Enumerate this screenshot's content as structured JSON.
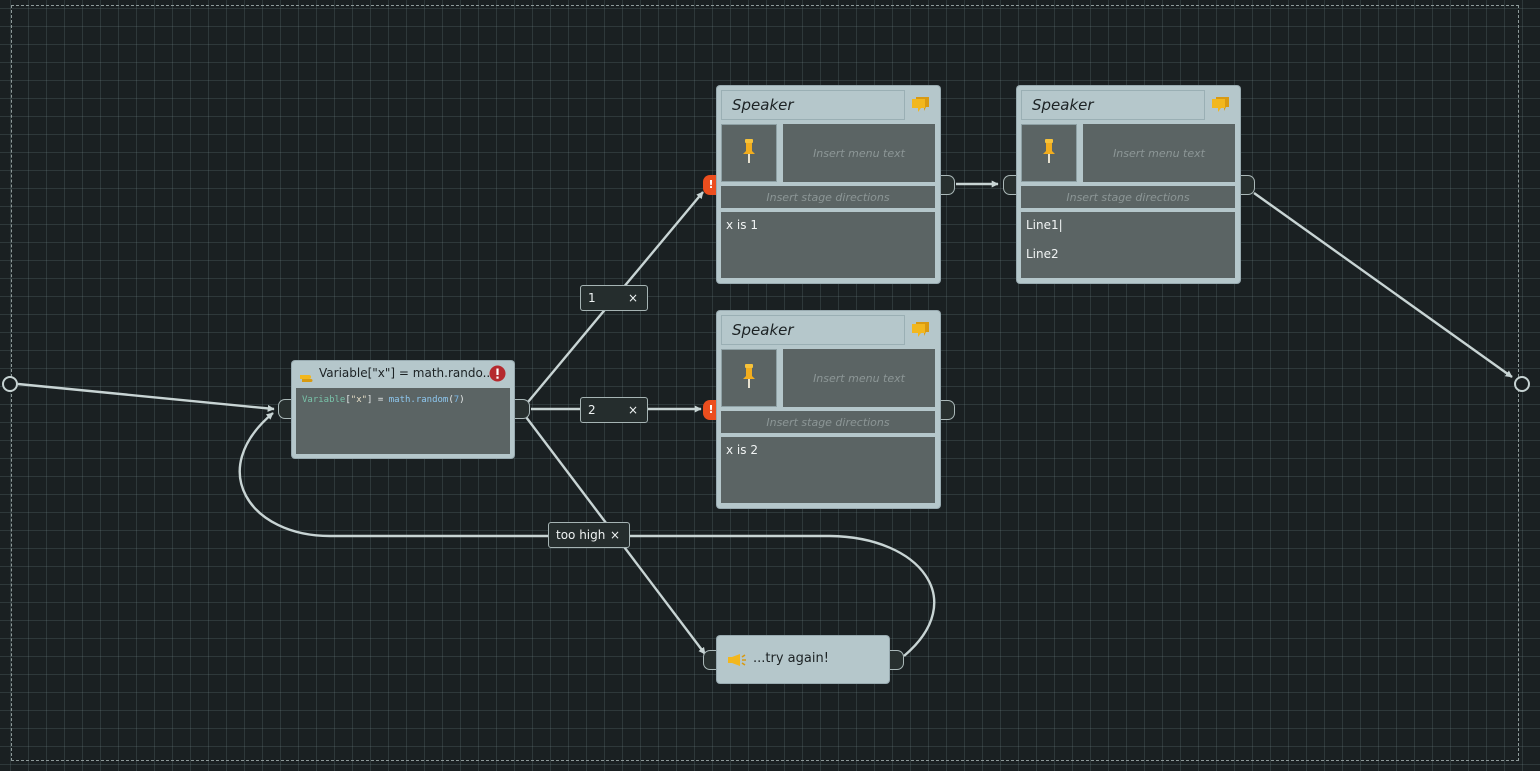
{
  "flow": {
    "speaker_nodes": [
      {
        "speaker": "Speaker",
        "menu_placeholder": "Insert menu text",
        "stage_placeholder": "Insert stage directions",
        "lines": [
          "x is 1"
        ]
      },
      {
        "speaker": "Speaker",
        "menu_placeholder": "Insert menu text",
        "stage_placeholder": "Insert stage directions",
        "lines": [
          "Line1|",
          "Line2"
        ]
      },
      {
        "speaker": "Speaker",
        "menu_placeholder": "Insert menu text",
        "stage_placeholder": "Insert stage directions",
        "lines": [
          "x is 2"
        ]
      }
    ],
    "script_node": {
      "title": "Variable[\"x\"] = math.rando...",
      "code": {
        "var": "Variable",
        "lb": "[",
        "str": "\"x\"",
        "rb": "]",
        "eq": " = ",
        "fn": "math.random",
        "lp": "(",
        "num": "7",
        "rp": ")"
      }
    },
    "conditions": [
      {
        "label": "1",
        "remove": "×"
      },
      {
        "label": "2",
        "remove": "×"
      },
      {
        "label": "too high",
        "remove": "×"
      }
    ],
    "try_node": {
      "text": "...try again!"
    },
    "errors": {
      "port_error": "!"
    }
  },
  "colors": {
    "background": "#1a2022",
    "node": "#b5c7cb",
    "field": "#5b6464",
    "wire": "#c8d4d4",
    "error": "#ec4e1e",
    "speech_icon": "#f2b71e"
  },
  "icons": {
    "speech": "speech-bubble-icon",
    "pin": "pin-icon",
    "script": "script-icon",
    "error": "error-icon",
    "megaphone": "megaphone-icon"
  }
}
